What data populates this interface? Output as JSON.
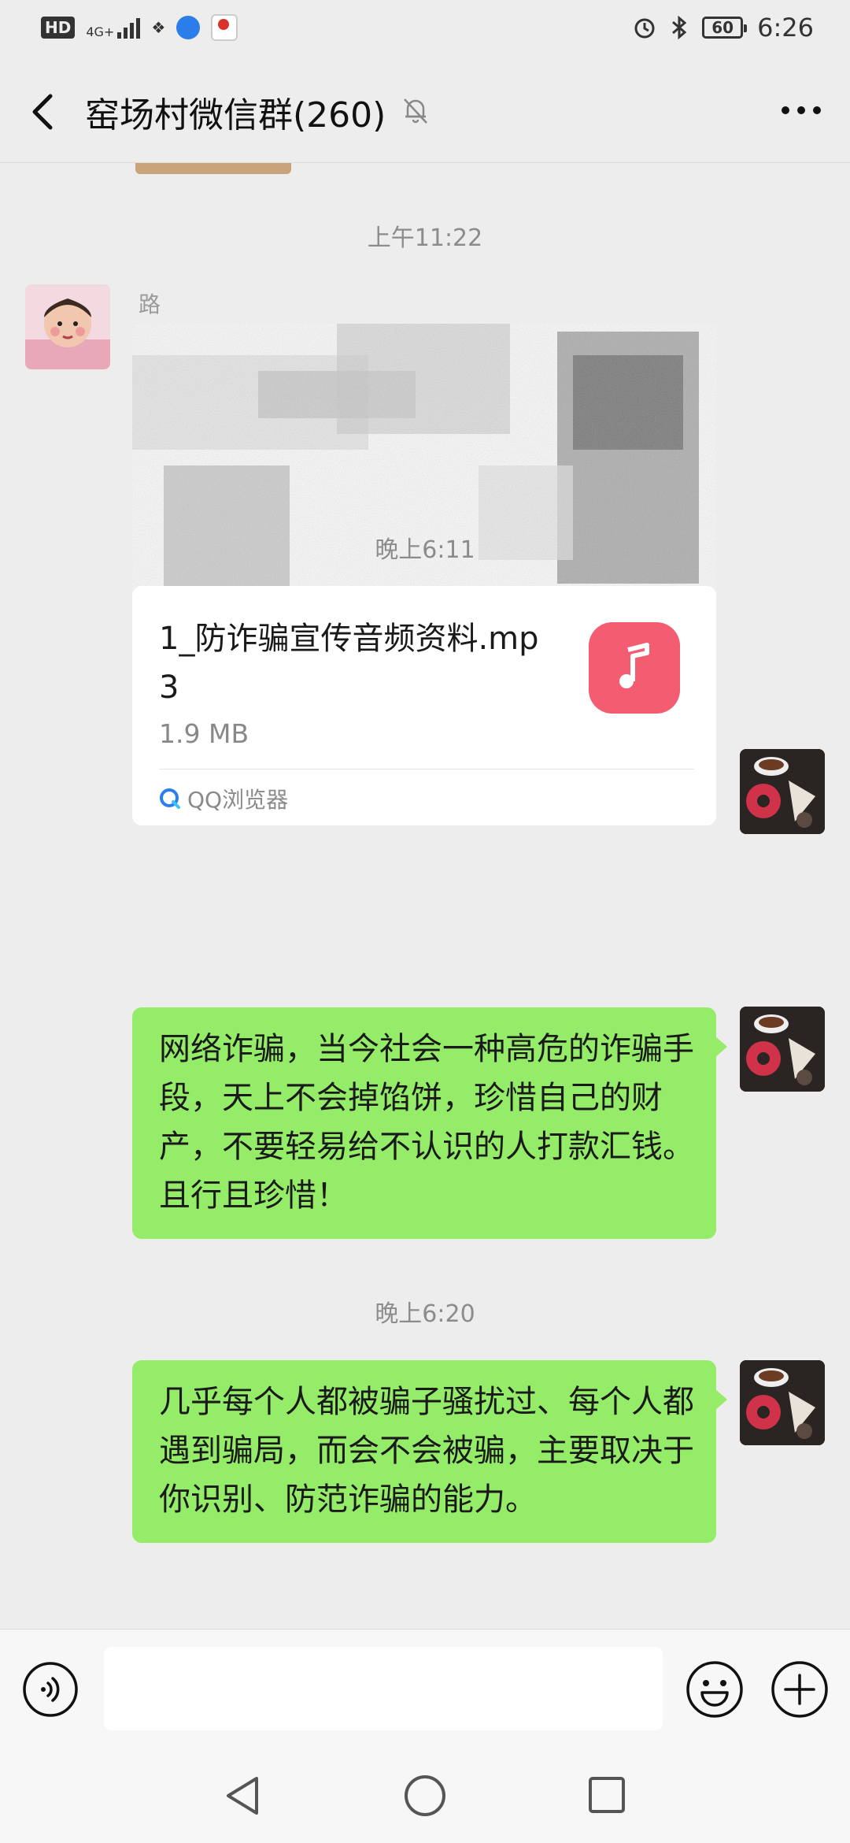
{
  "status_bar": {
    "hd_label": "HD",
    "network": "4G+",
    "battery": "60",
    "time": "6:26"
  },
  "nav": {
    "title": "窑场村微信群(260)"
  },
  "timestamps": {
    "t1": "上午11:22",
    "t2": "晚上6:11",
    "t3": "晚上6:20"
  },
  "messages": {
    "redacted_sender": "路",
    "file": {
      "name": "1_防诈骗宣传音频资料.mp3",
      "size": "1.9 MB",
      "source": "QQ浏览器"
    },
    "text1": "网络诈骗，当今社会一种高危的诈骗手段，天上不会掉馅饼，珍惜自己的财产，不要轻易给不认识的人打款汇钱。且行且珍惜！",
    "text2": "几乎每个人都被骗子骚扰过、每个人都遇到骗局，而会不会被骗，主要取决于你识别、防范诈骗的能力。"
  },
  "input": {
    "placeholder": ""
  },
  "colors": {
    "background": "#ededed",
    "bubble_green": "#95ec69",
    "music_icon": "#f45c72",
    "qq_blue": "#2a7ef0"
  }
}
